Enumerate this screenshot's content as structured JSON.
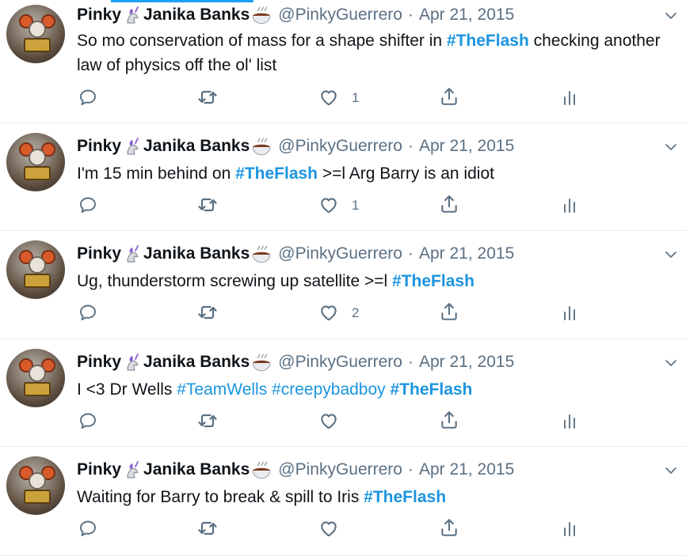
{
  "colors": {
    "accent": "#1da1f2",
    "hashtag": "#1b95e0",
    "muted": "#5b7083",
    "divider": "#e6ecf0"
  },
  "tweets": [
    {
      "name_part1": "Pinky",
      "name_part2": "Janika Banks",
      "handle": "@PinkyGuerrero",
      "sep": "·",
      "date": "Apr 21, 2015",
      "text_segments": [
        {
          "t": "So mo conservation of mass for a shape shifter in ",
          "k": "text"
        },
        {
          "t": "#TheFlash",
          "k": "hashb"
        },
        {
          "t": " checking another law of physics off the ol' list",
          "k": "text"
        }
      ],
      "like_count": "1"
    },
    {
      "name_part1": "Pinky",
      "name_part2": "Janika Banks",
      "handle": "@PinkyGuerrero",
      "sep": "·",
      "date": "Apr 21, 2015",
      "text_segments": [
        {
          "t": "I'm 15 min behind on ",
          "k": "text"
        },
        {
          "t": "#TheFlash",
          "k": "hashb"
        },
        {
          "t": " >=l Arg Barry is an idiot",
          "k": "text"
        }
      ],
      "like_count": "1"
    },
    {
      "name_part1": "Pinky",
      "name_part2": "Janika Banks",
      "handle": "@PinkyGuerrero",
      "sep": "·",
      "date": "Apr 21, 2015",
      "text_segments": [
        {
          "t": "Ug, thunderstorm screwing up satellite >=l ",
          "k": "text"
        },
        {
          "t": "#TheFlash",
          "k": "hashb"
        }
      ],
      "like_count": "2"
    },
    {
      "name_part1": "Pinky",
      "name_part2": "Janika Banks",
      "handle": "@PinkyGuerrero",
      "sep": "·",
      "date": "Apr 21, 2015",
      "text_segments": [
        {
          "t": "I <3 Dr Wells ",
          "k": "text"
        },
        {
          "t": "#TeamWells",
          "k": "hash"
        },
        {
          "t": " ",
          "k": "text"
        },
        {
          "t": "#creepybadboy",
          "k": "hash"
        },
        {
          "t": " ",
          "k": "text"
        },
        {
          "t": "#TheFlash",
          "k": "hashb"
        }
      ],
      "like_count": ""
    },
    {
      "name_part1": "Pinky",
      "name_part2": "Janika Banks",
      "handle": "@PinkyGuerrero",
      "sep": "·",
      "date": "Apr 21, 2015",
      "text_segments": [
        {
          "t": "Waiting for Barry to break & spill to Iris ",
          "k": "text"
        },
        {
          "t": "#TheFlash",
          "k": "hashb"
        }
      ],
      "like_count": ""
    }
  ],
  "icons": {
    "avatar": "robot-avatar-icon",
    "unicorn": "unicorn-emoji-icon",
    "bowl": "bowl-emoji-icon",
    "caret": "chevron-down-icon",
    "reply": "reply-icon",
    "retweet": "retweet-icon",
    "like": "heart-icon",
    "share": "share-icon",
    "analytics": "analytics-icon"
  }
}
